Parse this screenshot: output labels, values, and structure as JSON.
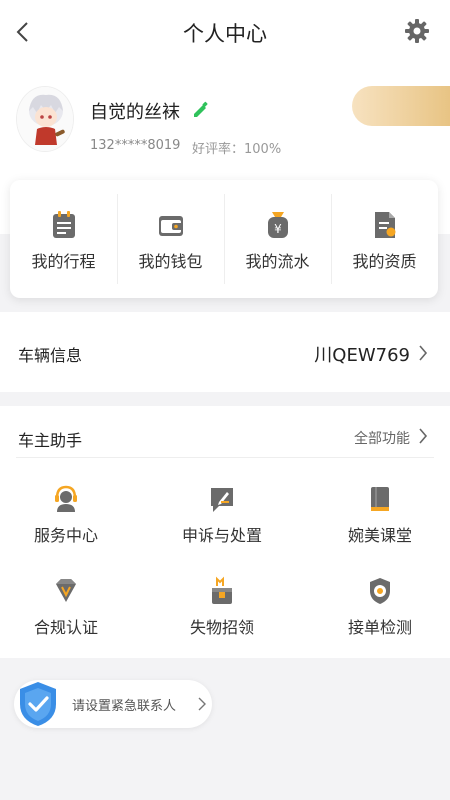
{
  "header": {
    "title": "个人中心",
    "back_icon": "chevron-left-icon",
    "settings_icon": "gear-icon"
  },
  "profile": {
    "nickname": "自觉的丝袜",
    "phone": "132*****8019",
    "rating": "好评率：100%",
    "edit_icon": "pencil-icon",
    "accent_color": "#2fc25b",
    "gold_color": "#e8c484"
  },
  "quick_actions": [
    {
      "label": "我的行程",
      "icon": "itinerary-icon"
    },
    {
      "label": "我的钱包",
      "icon": "wallet-icon"
    },
    {
      "label": "我的流水",
      "icon": "cashflow-icon"
    },
    {
      "label": "我的资质",
      "icon": "qualification-icon"
    }
  ],
  "vehicle": {
    "label": "车辆信息",
    "plate": "川QEW769"
  },
  "assistant": {
    "title": "车主助手",
    "all_label": "全部功能",
    "items": [
      {
        "label": "服务中心",
        "icon": "headset-icon"
      },
      {
        "label": "申诉与处置",
        "icon": "appeal-icon"
      },
      {
        "label": "婉美课堂",
        "icon": "book-icon"
      },
      {
        "label": "合规认证",
        "icon": "diamond-badge-icon"
      },
      {
        "label": "失物招领",
        "icon": "lost-found-icon"
      },
      {
        "label": "接单检测",
        "icon": "order-check-shield-icon"
      }
    ],
    "icon_orange": "#f5a623",
    "icon_gray": "#6b6b6b"
  },
  "emergency": {
    "text": "请设置紧急联系人",
    "icon": "shield-check-icon",
    "color": "#3a8ee6"
  }
}
